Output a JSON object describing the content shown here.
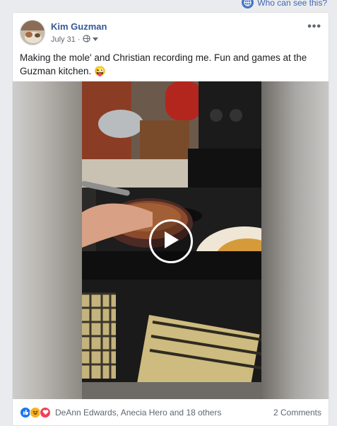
{
  "top_bar": {
    "who_can_see": "Who can see this?"
  },
  "post": {
    "author": "Kim Guzman",
    "date": "July 31",
    "separator": "·",
    "privacy_icon": "globe-icon",
    "caption": "Making the mole' and Christian recording me. Fun and games at the Guzman kitchen. 😜",
    "video": {
      "play_icon": "play-icon"
    },
    "reactions": {
      "icons": [
        "like-icon",
        "haha-icon",
        "love-icon"
      ],
      "names": "DeAnn Edwards, Anecia Hero and 18 others",
      "comments": "2 Comments"
    }
  },
  "colors": {
    "link": "#385898",
    "like": "#1877f2",
    "haha": "#f7b125",
    "love": "#f33e58"
  }
}
